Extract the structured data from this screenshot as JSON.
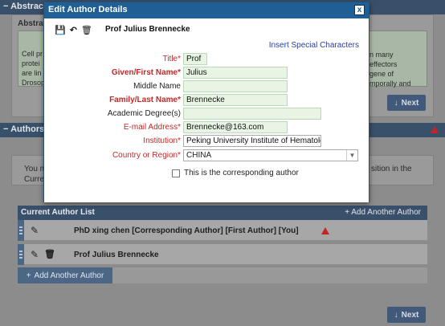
{
  "background": {
    "abstract_section_title": "Abstrac",
    "abstract_label": "Abstra",
    "abstract_text_fragments": [
      "Cell pr",
      "protei",
      "are lin",
      "Drosop"
    ],
    "abstract_text_right": [
      "n many",
      "effectors",
      "gene of",
      "mporally and"
    ],
    "next_label": "Next",
    "authors_section_title": "Authors",
    "authors_notice_left": [
      "You m",
      "Curre"
    ],
    "authors_notice_right": "sition in the",
    "current_author_list_title": "Current Author List",
    "add_another_author": "Add Another Author",
    "authors": [
      {
        "name": "PhD xing chen [Corresponding Author] [First Author] [You]",
        "has_warning": true,
        "can_delete": false
      },
      {
        "name": "Prof Julius Brennecke",
        "has_warning": false,
        "can_delete": true
      }
    ],
    "add_another_author_button": "Add Another Author",
    "next_bottom_label": "Next"
  },
  "modal": {
    "title": "Edit Author Details",
    "close_label": "x",
    "author_heading": "Prof Julius Brennecke",
    "insert_special_chars": "Insert Special Characters",
    "fields": {
      "title": {
        "label": "Title*",
        "value": "Prof"
      },
      "given_name": {
        "label": "Given/First Name*",
        "value": "Julius"
      },
      "middle_name": {
        "label": "Middle Name",
        "value": ""
      },
      "family_name": {
        "label": "Family/Last Name*",
        "value": "Brennecke"
      },
      "academic_degrees": {
        "label": "Academic Degree(s)",
        "value": ""
      },
      "email": {
        "label": "E-mail Address*",
        "value": "Brennecke@163.com"
      },
      "institution": {
        "label": "Institution*",
        "value": "Peking University Institute of Hematology"
      },
      "country": {
        "label": "Country or Region*",
        "value": "CHINA"
      }
    },
    "corresponding_label": "This is the corresponding author"
  },
  "colors": {
    "header_blue": "#1f5f95",
    "required_red": "#c62828",
    "field_green": "#e8f5e4",
    "link_blue": "#2a3ea6"
  }
}
